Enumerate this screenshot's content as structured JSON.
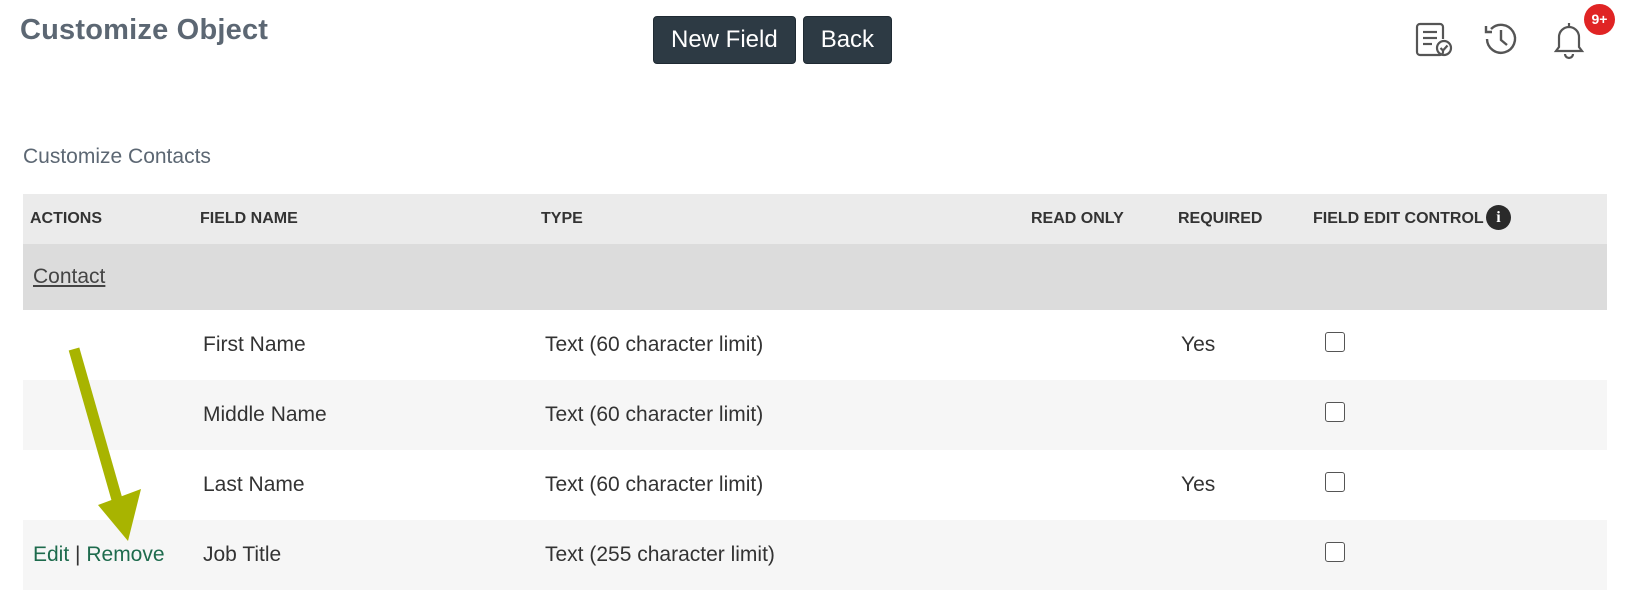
{
  "header": {
    "title": "Customize Object",
    "new_field_label": "New Field",
    "back_label": "Back",
    "icons": [
      "task-list-icon",
      "history-icon",
      "bell-icon"
    ],
    "notification_badge": "9+"
  },
  "section": {
    "title": "Customize Contacts"
  },
  "table": {
    "columns": [
      "ACTIONS",
      "FIELD NAME",
      "TYPE",
      "READ ONLY",
      "REQUIRED",
      "FIELD EDIT CONTROL"
    ],
    "group": "Contact",
    "rows": [
      {
        "actions": {
          "edit": "",
          "separator": "",
          "remove": ""
        },
        "field_name": "First Name",
        "type": "Text (60 character limit)",
        "read_only": "",
        "required": "Yes",
        "field_edit_control": false
      },
      {
        "actions": {
          "edit": "",
          "separator": "",
          "remove": ""
        },
        "field_name": "Middle Name",
        "type": "Text (60 character limit)",
        "read_only": "",
        "required": "",
        "field_edit_control": false
      },
      {
        "actions": {
          "edit": "",
          "separator": "",
          "remove": ""
        },
        "field_name": "Last Name",
        "type": "Text (60 character limit)",
        "read_only": "",
        "required": "Yes",
        "field_edit_control": false
      },
      {
        "actions": {
          "edit": "Edit",
          "separator": "|",
          "remove": "Remove"
        },
        "field_name": "Job Title",
        "type": "Text (255 character limit)",
        "read_only": "",
        "required": "",
        "field_edit_control": false
      }
    ]
  },
  "colors": {
    "button_bg": "#2d3a44",
    "link_green": "#1e6b4d",
    "arrow": "#a8b400",
    "badge": "#e02424"
  }
}
